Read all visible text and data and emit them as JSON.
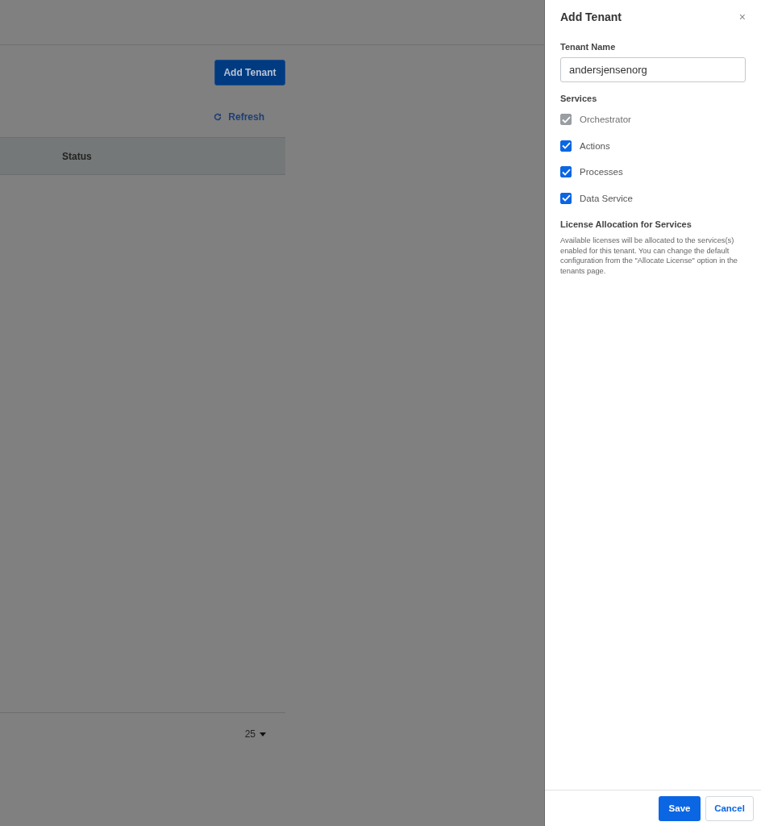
{
  "page": {
    "add_button": "Add Tenant",
    "refresh": "Refresh",
    "table": {
      "columns": [
        "Status"
      ]
    },
    "page_size": "25"
  },
  "panel": {
    "title": "Add Tenant",
    "close": "×",
    "name_label": "Tenant Name",
    "name_value": "andersjensenorg",
    "services_label": "Services",
    "services": [
      {
        "label": "Orchestrator",
        "checked": true,
        "disabled": true
      },
      {
        "label": "Actions",
        "checked": true,
        "disabled": false
      },
      {
        "label": "Processes",
        "checked": true,
        "disabled": false
      },
      {
        "label": "Data Service",
        "checked": true,
        "disabled": false
      }
    ],
    "license_title": "License Allocation for Services",
    "license_text": "Available licenses will be allocated to the services(s) enabled for this tenant. You can change the default configuration from the \"Allocate License\" option in the tenants page.",
    "buttons": [
      {
        "label": "Save",
        "kind": "primary"
      },
      {
        "label": "Cancel",
        "kind": "secondary"
      }
    ]
  }
}
